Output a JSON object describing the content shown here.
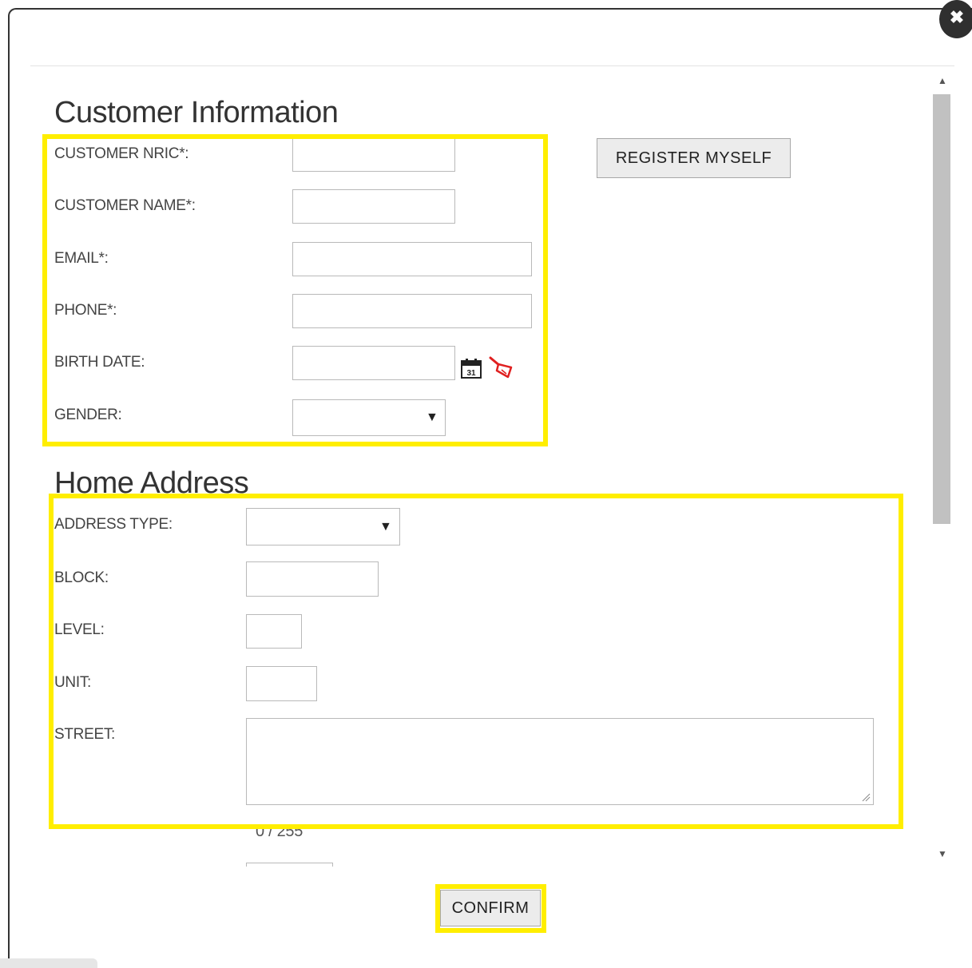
{
  "dialog": {
    "close_icon": "close-icon",
    "close_glyph": "✖"
  },
  "customer_info": {
    "title": "Customer Information",
    "nric_label": "CUSTOMER NRIC*:",
    "name_label": "CUSTOMER NAME*:",
    "email_label": "EMAIL*:",
    "phone_label": "PHONE*:",
    "birth_date_label": "BIRTH DATE:",
    "gender_label": "GENDER:",
    "gender_value": "",
    "nric_value": "",
    "name_value": "",
    "email_value": "",
    "phone_value": "",
    "birth_date_value": "",
    "calendar_icon": "calendar-icon",
    "calendar_glyph": "31",
    "clear_icon": "broom-clear-icon",
    "register_myself_label": "REGISTER MYSELF"
  },
  "home_address": {
    "title": "Home Address",
    "address_type_label": "ADDRESS TYPE:",
    "address_type_value": "",
    "block_label": "BLOCK:",
    "level_label": "LEVEL:",
    "unit_label": "UNIT:",
    "street_label": "STREET:",
    "street_char_count": "0 / 255"
  },
  "footer": {
    "confirm_label": "CONFIRM"
  },
  "scrollbar": {
    "up_glyph": "▲",
    "down_glyph": "▼"
  },
  "colors": {
    "highlight": "#ffee00",
    "close_bg": "#2f2f2f",
    "clear_icon": "#e02020"
  }
}
